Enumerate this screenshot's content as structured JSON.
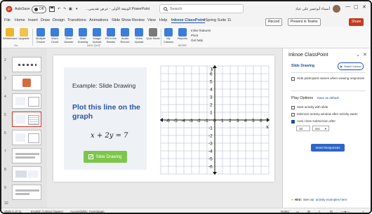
{
  "title_bar": {
    "autosave_label": "AutoSave",
    "autosave_state": "Off",
    "file_name": "...الوثيقة الأولى - عرض تقديمي PowerPoint",
    "search_placeholder": "Search",
    "user_name": "أسماء أبوعمير على عياد",
    "min_icon": "—",
    "max_icon": "▢",
    "close_icon": "✕"
  },
  "ribbon_tabs": [
    "File",
    "Home",
    "Insert",
    "Draw",
    "Design",
    "Transitions",
    "Animations",
    "Slide Show",
    "Review",
    "View",
    "Help",
    "Inknoe ClassPoint",
    "iSpring Suite 11"
  ],
  "ribbon_buttons": {
    "record": "Record",
    "present": "Present in Teams",
    "share": "Share"
  },
  "ribbon_items": [
    {
      "label": "Whiteboard",
      "color": "#f0b429"
    },
    {
      "label": "Upgrade",
      "color": "#f2c14e"
    },
    {
      "label": "Multiple Choice",
      "color": "#3b7dd8"
    },
    {
      "label": "Word Cloud",
      "color": "#3b7dd8"
    },
    {
      "label": "Short Answer",
      "color": "#3b7dd8"
    },
    {
      "label": "Slide Drawing",
      "color": "#3b7dd8"
    },
    {
      "label": "Image Upload",
      "color": "#3b7dd8"
    },
    {
      "label": "Fill in the Blanks",
      "color": "#3b7dd8"
    },
    {
      "label": "Audio Record",
      "color": "#3b7dd8"
    },
    {
      "label": "Video Upload",
      "color": "#3b7dd8"
    },
    {
      "label": "Quiz Mode",
      "color": "#7a7a7a"
    },
    {
      "label": "My Classes",
      "color": "#3b7dd8"
    },
    {
      "label": "Reports",
      "color": "#3b7dd8"
    }
  ],
  "ribbon_small": [
    "Inline features",
    "Pivot",
    "Get help"
  ],
  "ribbon_groups": [
    "Go",
    "ADD QUIZ",
    "MORE"
  ],
  "thumbnails": [
    "2",
    "3",
    "4",
    "5",
    "6",
    "7",
    "8",
    "9",
    "10"
  ],
  "slide": {
    "example_title": "Example: Slide Drawing",
    "plot_title": "Plot this line on the graph",
    "equation": "x + 2y = 7",
    "draw_button": "Slide Drawing",
    "axis_y": "y",
    "axis_x": "x",
    "x_ticks": [
      "-6",
      "-5",
      "-4",
      "-3",
      "-2",
      "-1",
      "0",
      "1",
      "2",
      "3",
      "4",
      "5",
      "6"
    ],
    "y_ticks": [
      "6",
      "5",
      "4",
      "3",
      "2",
      "1",
      "-1",
      "-2",
      "-3",
      "-4",
      "-5",
      "-6"
    ]
  },
  "task_pane": {
    "title": "Inknoe ClassPoint",
    "subtitle": "Slide Drawing",
    "watch_label": "Watch tutorial",
    "option_hide_names": "Hide participant names when viewing responses",
    "play_options": "Play Options",
    "save_default": "Save as default",
    "opt_start_slide": "Start activity with slide",
    "opt_minimize": "Minimize activity window after activity starts",
    "opt_auto_close": "Auto close submission after",
    "auto_close_value": "15",
    "auto_close_unit": "sec",
    "insert_button": "Insert Responses",
    "hint_prefix": "Hint:",
    "hint_text": "See our",
    "hint_link": "activity examples here"
  },
  "status_bar": {
    "slide_info": "Slide 5 of 11",
    "language": "English (United States)",
    "accessibility": "Accessibility: Investigate",
    "notes": "Notes",
    "zoom": "+"
  }
}
